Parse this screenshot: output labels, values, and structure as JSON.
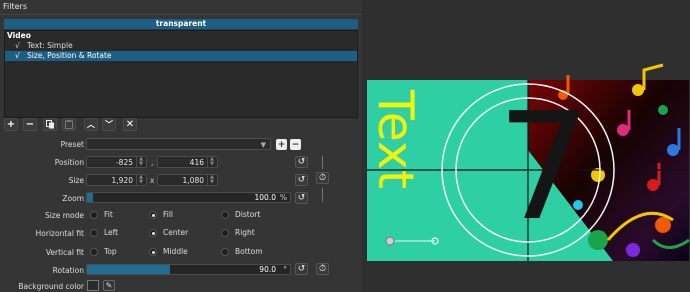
{
  "window": {
    "title": "Filters"
  },
  "clip": {
    "name": "transparent"
  },
  "filter_list": {
    "section": "Video",
    "items": [
      {
        "check": "√",
        "label": "Text: Simple",
        "selected": false
      },
      {
        "check": "√",
        "label": "Size, Position & Rotate",
        "selected": true
      }
    ]
  },
  "toolbar": {
    "add_icon": "plus-icon",
    "remove_icon": "minus-icon",
    "copy_icon": "copy-icon",
    "paste_icon": "paste-icon",
    "move_up_icon": "chevron-up-icon",
    "move_down_icon": "chevron-down-icon",
    "deselect_icon": "close-icon"
  },
  "preset": {
    "label": "Preset",
    "value": ""
  },
  "position": {
    "label": "Position",
    "x": "-825",
    "sep": ",",
    "y": "416"
  },
  "size": {
    "label": "Size",
    "w": "1,920",
    "sep": "x",
    "h": "1,080"
  },
  "zoom": {
    "label": "Zoom",
    "value": "100.0",
    "unit": "%",
    "fill_fraction": 0.03
  },
  "size_mode": {
    "label": "Size mode",
    "options": [
      "Fit",
      "Fill",
      "Distort"
    ],
    "selected": "Fill"
  },
  "horizontal_fit": {
    "label": "Horizontal fit",
    "options": [
      "Left",
      "Center",
      "Right"
    ],
    "selected": "Center"
  },
  "vertical_fit": {
    "label": "Vertical fit",
    "options": [
      "Top",
      "Middle",
      "Bottom"
    ],
    "selected": "Middle"
  },
  "rotation": {
    "label": "Rotation",
    "value": "90.0",
    "unit": "°",
    "fill_fraction": 0.41
  },
  "background_color": {
    "label": "Background color",
    "color": "#2b2b2b"
  },
  "viewer": {
    "overlay_text": "Text",
    "countdown_number": "7",
    "colors": {
      "teal": "#2ecfa4",
      "text_yellow": "#f2f20a",
      "accent": "#1d5f84"
    }
  }
}
